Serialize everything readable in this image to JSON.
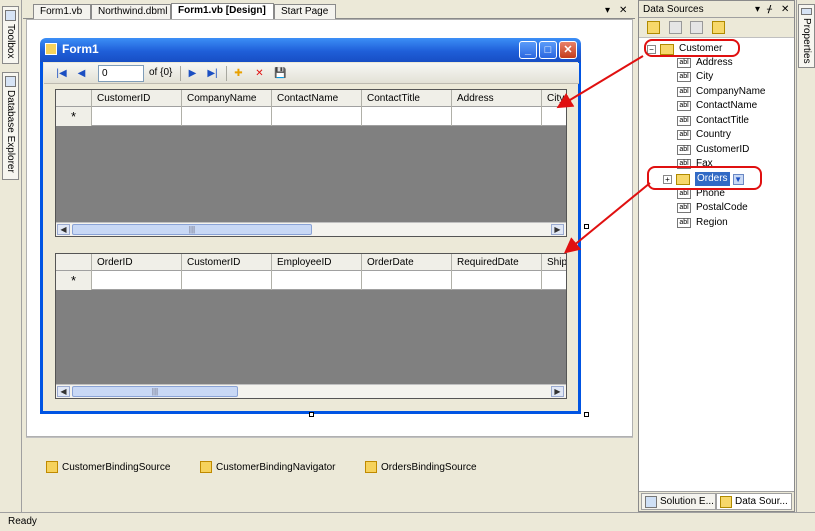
{
  "left_strip": {
    "toolbox": "Toolbox",
    "database_explorer": "Database Explorer"
  },
  "right_strip": {
    "properties": "Properties"
  },
  "document_tabs": [
    {
      "label": "Form1.vb"
    },
    {
      "label": "Northwind.dbml"
    },
    {
      "label": "Form1.vb [Design]"
    },
    {
      "label": "Start Page"
    }
  ],
  "tab_controls": {
    "dropdown": "▾",
    "close": "✕"
  },
  "form": {
    "title": "Form1",
    "buttons": {
      "minimize": "_",
      "maximize": "□",
      "close": "✕"
    },
    "navigator": {
      "position_value": "0",
      "count_text": "of {0}",
      "move_first": "|◀",
      "move_prev": "◀",
      "move_next": "▶",
      "move_last": "▶|",
      "add_new": "✚",
      "delete": "✕",
      "save": "💾"
    },
    "customer_grid": {
      "columns": [
        "CustomerID",
        "CompanyName",
        "ContactName",
        "ContactTitle",
        "Address",
        "City"
      ],
      "new_row_marker": "*",
      "scroll_thumb": "|||"
    },
    "orders_grid": {
      "columns": [
        "OrderID",
        "CustomerID",
        "EmployeeID",
        "OrderDate",
        "RequiredDate",
        "Ship"
      ],
      "new_row_marker": "*",
      "scroll_thumb": "|||"
    }
  },
  "component_tray": [
    {
      "label": "CustomerBindingSource"
    },
    {
      "label": "CustomerBindingNavigator"
    },
    {
      "label": "OrdersBindingSource"
    }
  ],
  "data_sources": {
    "title": "Data Sources",
    "title_controls": {
      "dropdown": "▾",
      "pin": "ᚋ",
      "close": "✕"
    },
    "root": "Customer",
    "fields_before": [
      "Address",
      "City",
      "CompanyName",
      "ContactName",
      "ContactTitle",
      "Country",
      "CustomerID",
      "Fax"
    ],
    "child": "Orders",
    "fields_after": [
      "Phone",
      "PostalCode",
      "Region"
    ],
    "field_type_badge": "abl",
    "bottom_tabs": [
      {
        "label": "Solution E..."
      },
      {
        "label": "Data Sour..."
      }
    ]
  },
  "status_bar": {
    "text": "Ready"
  },
  "colors": {
    "accent": "#316ac5",
    "annotation": "#e01010",
    "form_border": "#0054e3",
    "grid_background": "#808080"
  }
}
